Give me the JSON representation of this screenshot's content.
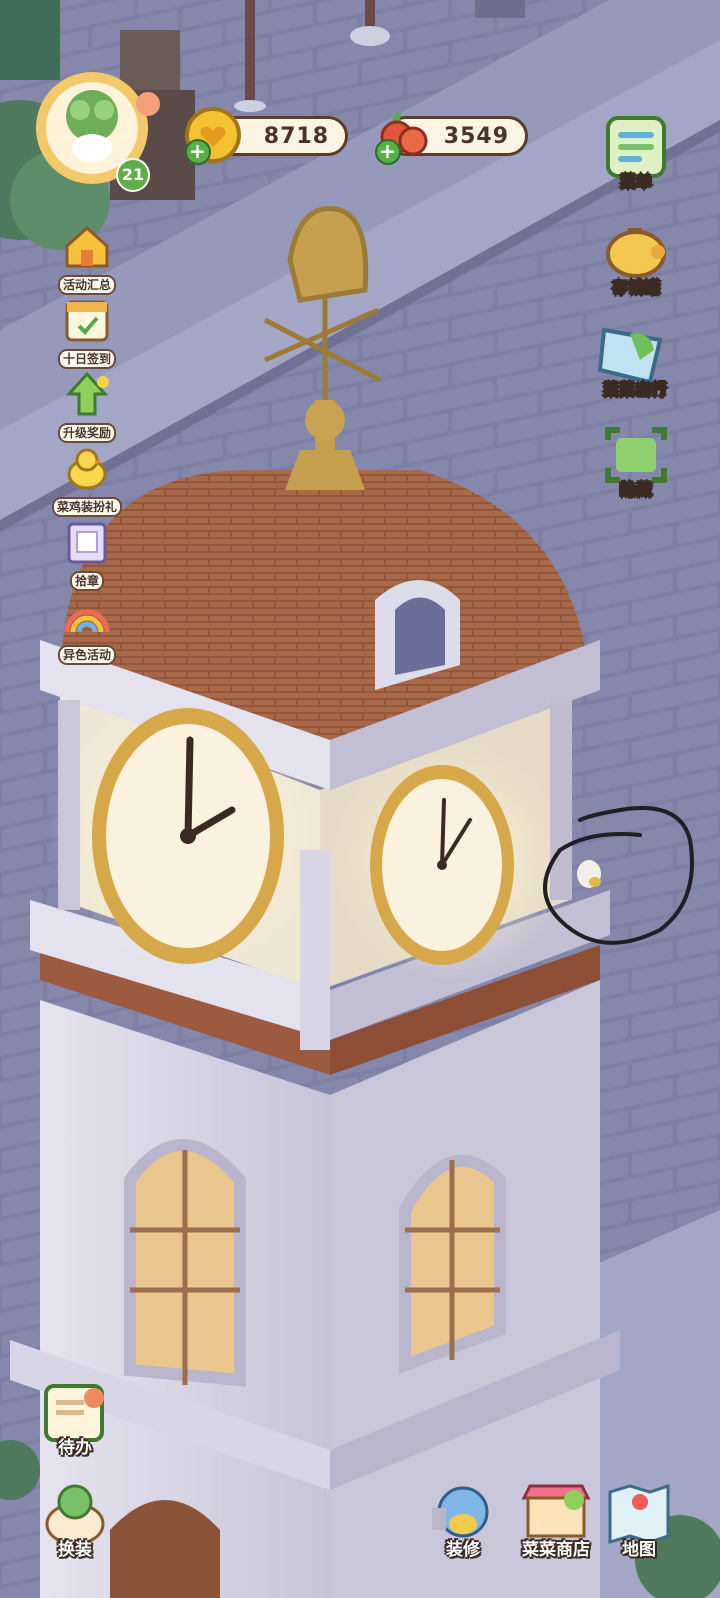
{
  "hud": {
    "level": "21",
    "coins": "8718",
    "produce": "3549"
  },
  "left_menu": [
    {
      "label": "活动汇总",
      "icon": "house-event-icon"
    },
    {
      "label": "十日签到",
      "icon": "signin-calendar-icon"
    },
    {
      "label": "升级奖励",
      "icon": "upgrade-reward-icon"
    },
    {
      "label": "菜鸡装扮礼",
      "icon": "chick-outfit-icon"
    },
    {
      "label": "拾章",
      "icon": "stamp-album-icon"
    },
    {
      "label": "异色活动",
      "icon": "rainbow-event-icon"
    }
  ],
  "right_menu": [
    {
      "label": "菜单",
      "icon": "menu-board-icon"
    },
    {
      "label": "存钱罐",
      "icon": "piggy-bank-icon"
    },
    {
      "label": "菜菜出行",
      "icon": "travel-map-icon"
    },
    {
      "label": "隐藏",
      "icon": "hide-frame-icon"
    }
  ],
  "bottom_left": [
    {
      "label": "待办",
      "icon": "todo-calendar-icon"
    },
    {
      "label": "换装",
      "icon": "outfit-icon"
    }
  ],
  "bottom_right": [
    {
      "label": "装修",
      "icon": "decorate-icon"
    },
    {
      "label": "菜菜商店",
      "icon": "shop-icon"
    },
    {
      "label": "地图",
      "icon": "map-icon"
    }
  ],
  "colors": {
    "pavement": "#7f83a6",
    "brick": "#8a7fa6",
    "roof": "#a8684a",
    "tower_wall": "#d9d7e6",
    "clock_face": "#fbf1df",
    "clock_rim": "#d6a84a"
  }
}
